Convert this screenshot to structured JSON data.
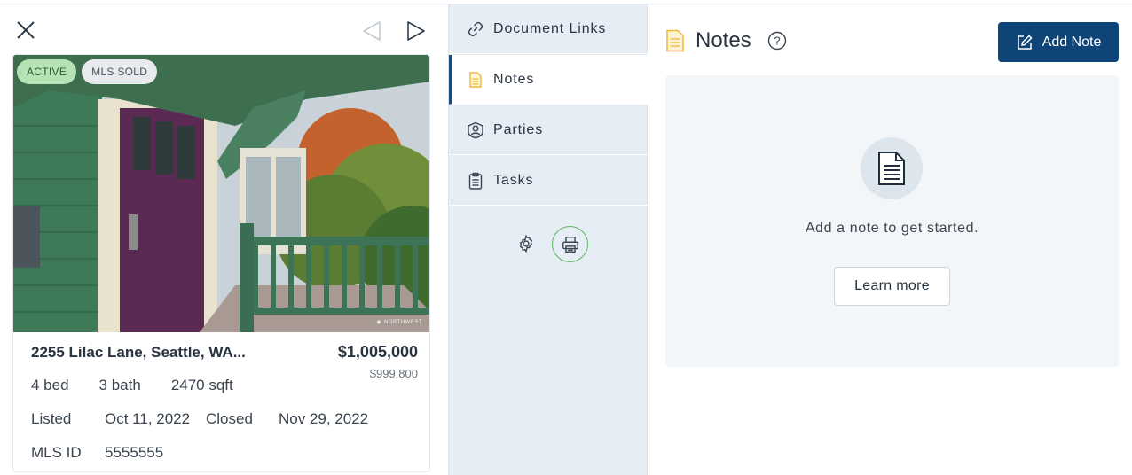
{
  "listing": {
    "badges": {
      "active": "ACTIVE",
      "mls_sold": "MLS SOLD"
    },
    "address": "2255 Lilac Lane, Seattle, WA...",
    "price": "$1,005,000",
    "original_price": "$999,800",
    "beds": "4 bed",
    "baths": "3 bath",
    "sqft": "2470 sqft",
    "listed_label": "Listed",
    "listed_date": "Oct 11, 2022",
    "closed_label": "Closed",
    "closed_date": "Nov 29, 2022",
    "mls_label": "MLS ID",
    "mls_id": "5555555",
    "photo_watermark": "NORTHWEST"
  },
  "nav": {
    "items": [
      {
        "label": "Document Links",
        "icon": "link-icon"
      },
      {
        "label": "Notes",
        "icon": "note-icon",
        "selected": true
      },
      {
        "label": "Parties",
        "icon": "person-icon"
      },
      {
        "label": "Tasks",
        "icon": "clipboard-icon"
      }
    ]
  },
  "notes": {
    "title": "Notes",
    "add_button": "Add Note",
    "empty_message": "Add a note to get started.",
    "learn_more": "Learn more"
  },
  "colors": {
    "primary": "#0f4477",
    "nav_bg": "#e6edf5",
    "active_badge": "#b6e3b6",
    "print_ring": "#5cb85c",
    "note_icon": "#f0b93a"
  }
}
